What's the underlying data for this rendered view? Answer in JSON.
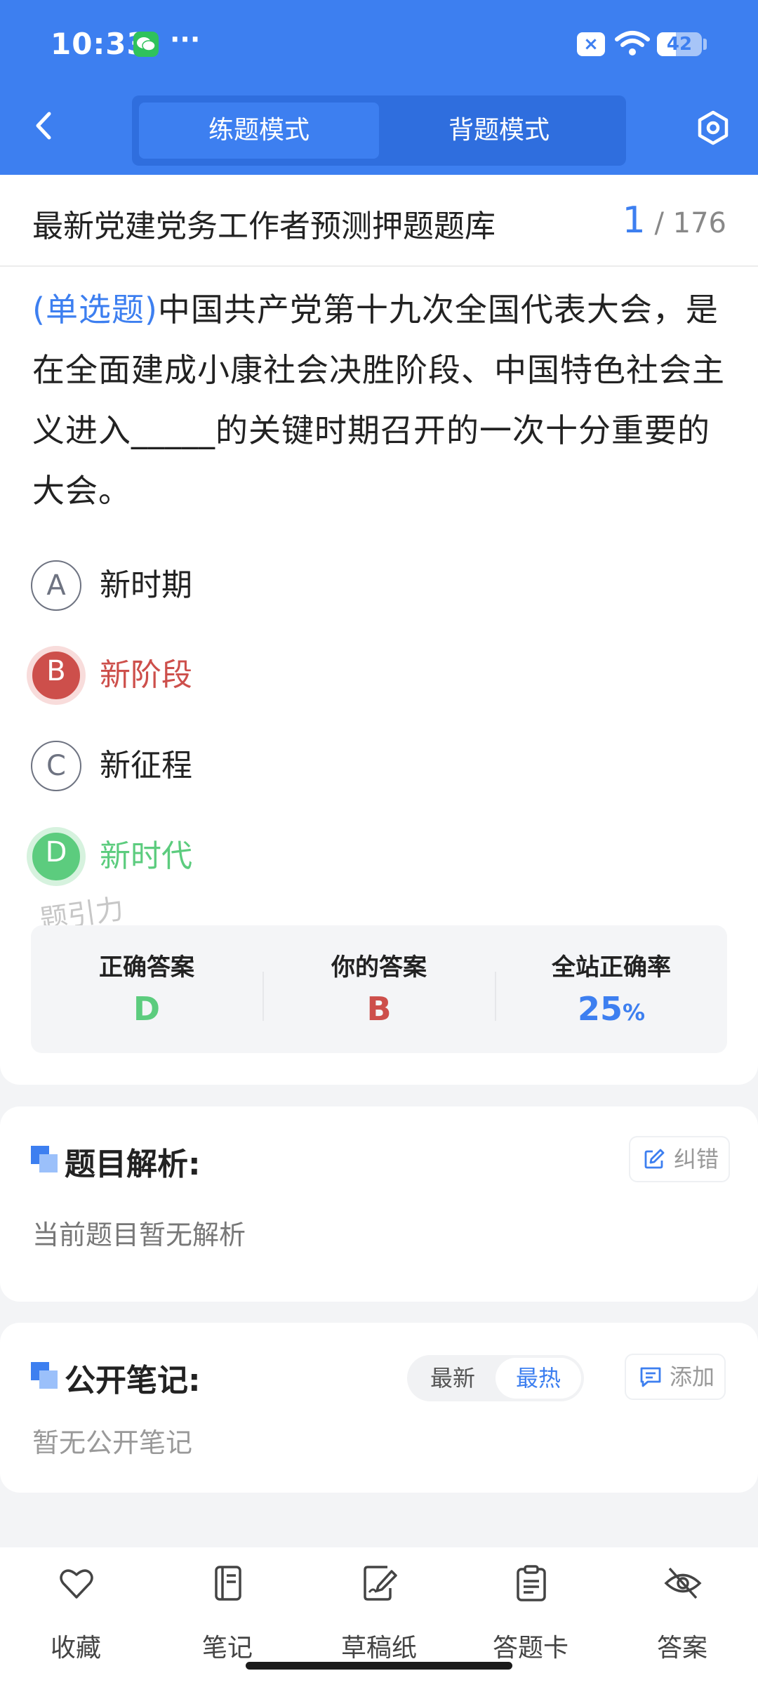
{
  "status_bar": {
    "time": "10:33",
    "more": "···",
    "sim_badge": "×",
    "battery": 42
  },
  "header": {
    "modes": [
      "练题模式",
      "背题模式"
    ],
    "active_mode": "练题模式"
  },
  "bank": {
    "title": "最新党建党务工作者预测押题题库",
    "current": "1",
    "total": "/ 176"
  },
  "question": {
    "type": "(单选题)",
    "text": "中国共产党第十九次全国代表大会，是在全面建成小康社会决胜阶段、中国特色社会主义进入_____的关键时期召开的一次十分重要的大会。",
    "options": [
      {
        "letter": "A",
        "text": "新时期",
        "state": "normal"
      },
      {
        "letter": "B",
        "text": "新阶段",
        "state": "wrong"
      },
      {
        "letter": "C",
        "text": "新征程",
        "state": "normal"
      },
      {
        "letter": "D",
        "text": "新时代",
        "state": "right"
      }
    ]
  },
  "watermark": "题引力",
  "result": {
    "correct_label": "正确答案",
    "correct_value": "D",
    "yours_label": "你的答案",
    "yours_value": "B",
    "rate_label": "全站正确率",
    "rate_value": "25",
    "rate_unit": "%"
  },
  "analysis": {
    "title": "题目解析:",
    "body": "当前题目暂无解析",
    "action": "纠错"
  },
  "notes": {
    "title": "公开笔记:",
    "body": "暂无公开笔记",
    "sort": [
      "最新",
      "最热"
    ],
    "active_sort": "最热",
    "action": "添加"
  },
  "toolbar": {
    "items": [
      "收藏",
      "笔记",
      "草稿纸",
      "答题卡",
      "答案"
    ]
  },
  "colors": {
    "primary": "#3d7ff0",
    "wrong": "#cd4f4b",
    "right": "#5ccc7e"
  }
}
